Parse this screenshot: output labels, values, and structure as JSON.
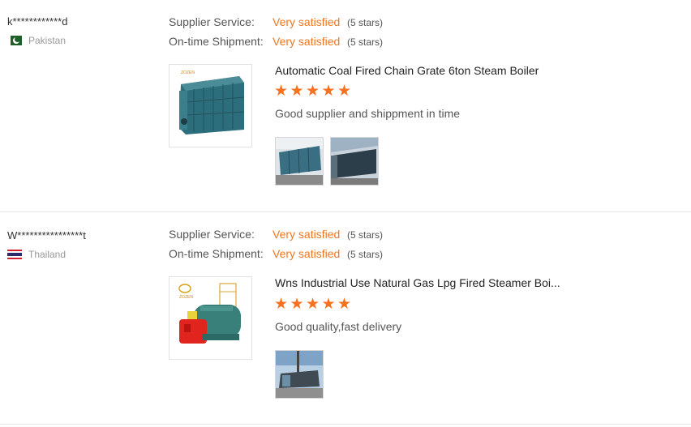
{
  "reviews": [
    {
      "user": "k************d",
      "country": "Pakistan",
      "supplier_service_label": "Supplier Service:",
      "supplier_service_value": "Very satisfied",
      "supplier_service_stars": "(5 stars)",
      "shipment_label": "On-time Shipment:",
      "shipment_value": "Very satisfied",
      "shipment_stars": "(5 stars)",
      "product_title": "Automatic Coal Fired Chain Grate 6ton Steam Boiler",
      "rating": 5,
      "comment": "Good supplier and shippment in time",
      "brand_text": "ZOZEN"
    },
    {
      "user": "W****************t",
      "country": "Thailand",
      "supplier_service_label": "Supplier Service:",
      "supplier_service_value": "Very satisfied",
      "supplier_service_stars": "(5 stars)",
      "shipment_label": "On-time Shipment:",
      "shipment_value": "Very satisfied",
      "shipment_stars": "(5 stars)",
      "product_title": "Wns Industrial Use Natural Gas Lpg Fired Steamer Boi...",
      "rating": 5,
      "comment": "Good quality,fast delivery",
      "brand_text": "ZOZEN"
    }
  ],
  "star_char": "★",
  "colors": {
    "accent": "#f0761f",
    "star": "#f7711f",
    "divider": "#e6e6e6"
  }
}
